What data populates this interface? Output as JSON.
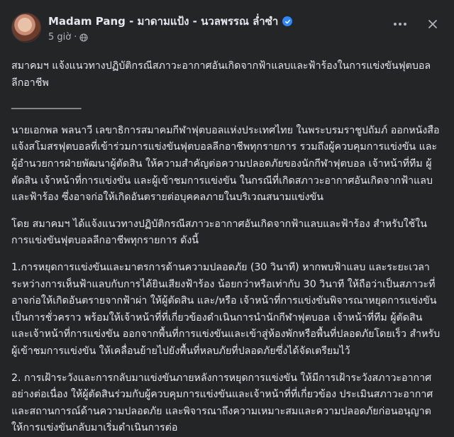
{
  "author": {
    "name": "Madam Pang - มาดามแป้ง - นวลพรรณ ล่ำซำ",
    "time": "5 giờ",
    "separator": "·"
  },
  "icons": {
    "verified": "verified-badge-icon",
    "privacy": "globe-icon",
    "more": "more-options-icon",
    "close": "close-icon"
  },
  "colors": {
    "background": "#242526",
    "text": "#e4e6eb",
    "muted": "#b0b3b8",
    "verified": "#2d88ff"
  },
  "post": {
    "title": "สมาคมฯ แจ้งแนวทางปฏิบัติกรณีสภาวะอากาศอันเกิดจากฟ้าแลบและฟ้าร้องในการแข่งขันฟุตบอลลีกอาชีพ",
    "divider": "________________",
    "paragraphs": [
      "นายเอกพล พลนาวี เลขาธิการสมาคมกีฬาฟุตบอลแห่งประเทศไทย ในพระบรมราชูปถัมภ์ ออกหนังสือแจ้งสโมสรฟุตบอลที่เข้าร่วมการแข่งขันฟุตบอลลีกอาชีพทุกรายการ รวมถึงผู้ควบคุมการแข่งขัน และผู้อำนวยการฝ่ายพัฒนาผู้ตัดสิน ให้ความสำคัญต่อความปลอดภัยของนักกีฬาฟุตบอล เจ้าหน้าที่ทีม ผู้ตัดสิน เจ้าหน้าที่การแข่งขัน และผู้เข้าชมการแข่งขัน ในกรณีที่เกิดสภาวะอากาศอันเกิดจากฟ้าแลบและฟ้าร้อง ซึ่งอาจก่อให้เกิดอันตรายต่อบุคคลภายในบริเวณสนามแข่งขัน",
      "โดย สมาคมฯ ได้แจ้งแนวทางปฏิบัติกรณีสภาวะอากาศอันเกิดจากฟ้าแลบและฟ้าร้อง สำหรับใช้ในการแข่งขันฟุตบอลลีกอาชีพทุกรายการ ดังนี้",
      "1.การหยุดการแข่งขันและมาตรการด้านความปลอดภัย (30 วินาที) หากพบฟ้าแลบ และระยะเวลาระหว่างการเห็นฟ้าแลบกับการได้ยินเสียงฟ้าร้อง น้อยกว่าหรือเท่ากับ 30 วินาที ให้ถือว่าเป็นสภาวะที่อาจก่อให้เกิดอันตรายจากฟ้าผ่า ให้ผู้ตัดสิน และ/หรือ เจ้าหน้าที่การแข่งขันพิจารณาหยุดการแข่งขันเป็นการชั่วคราว พร้อมให้เจ้าหน้าที่ที่เกี่ยวข้องดำเนินการนำนักกีฬาฟุตบอล เจ้าหน้าที่ทีม ผู้ตัดสิน และเจ้าหน้าที่การแข่งขัน ออกจากพื้นที่การแข่งขันและเข้าสู่ห้องพักหรือพื้นที่ปลอดภัยโดยเร็ว สำหรับผู้เข้าชมการแข่งขัน ให้เคลื่อนย้ายไปยังพื้นที่หลบภัยที่ปลอดภัยซึ่งได้จัดเตรียมไว้",
      "2. การเฝ้าระวังและการกลับมาแข่งขันภายหลังการหยุดการแข่งขัน ให้มีการเฝ้าระวังสภาวะอากาศอย่างต่อเนื่อง ให้ผู้ตัดสินร่วมกับผู้ควบคุมการแข่งขันและเจ้าหน้าที่ที่เกี่ยวข้อง ประเมินสภาวะอากาศและสถานการณ์ด้านความปลอดภัย และพิจารณาถึงความเหมาะสมและความปลอดภัยก่อนอนุญาตให้การแข่งขันกลับมาเริ่มดำเนินการต่อ"
    ]
  }
}
